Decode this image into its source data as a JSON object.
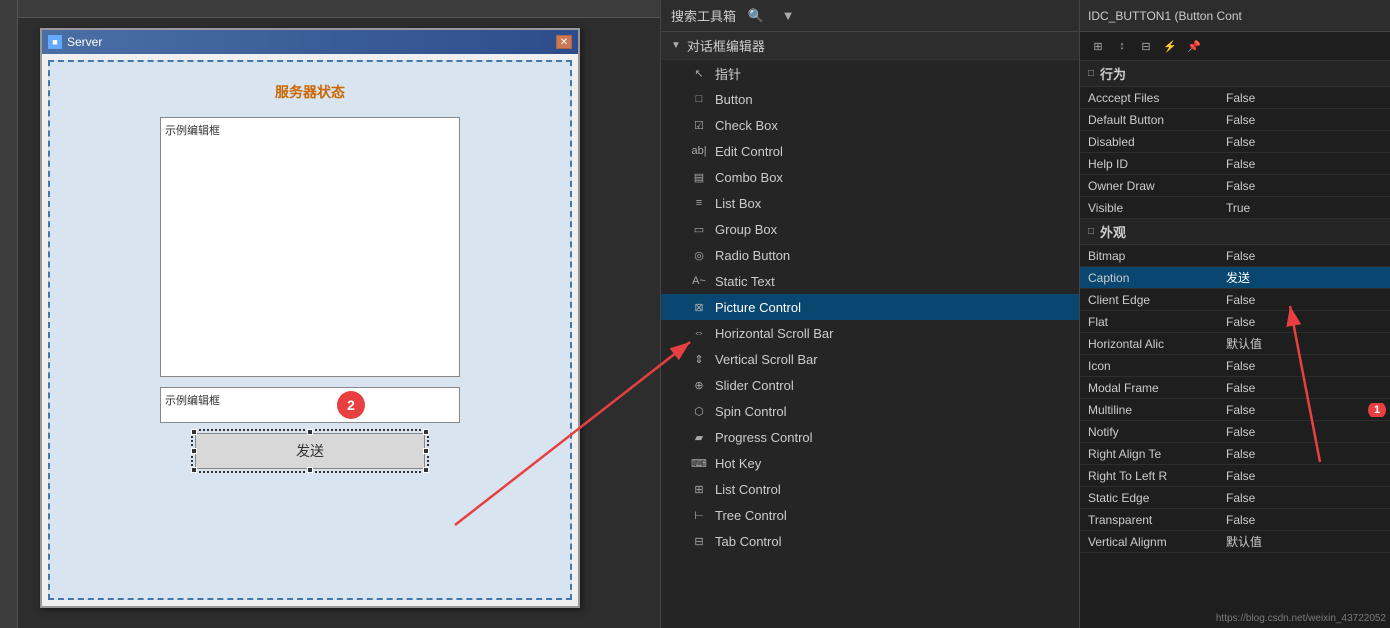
{
  "header": {
    "title": "IDC_BUTTON1 (Button Cont",
    "search_placeholder": "搜索工具箱"
  },
  "left_panel": {
    "dialog_title": "Server",
    "server_status": "服务器状态",
    "edit_box_label1": "示例编辑框",
    "edit_box_label2": "示例编辑框",
    "send_button_label": "发送"
  },
  "toolbox": {
    "category": "对话框编辑器",
    "items": [
      {
        "icon": "cursor",
        "label": "指针",
        "selected": false
      },
      {
        "icon": "button",
        "label": "Button",
        "selected": false
      },
      {
        "icon": "checkbox",
        "label": "Check Box",
        "selected": false
      },
      {
        "icon": "edit",
        "label": "Edit Control",
        "selected": false
      },
      {
        "icon": "combo",
        "label": "Combo Box",
        "selected": false
      },
      {
        "icon": "listbox",
        "label": "List Box",
        "selected": false
      },
      {
        "icon": "groupbox",
        "label": "Group Box",
        "selected": false
      },
      {
        "icon": "radio",
        "label": "Radio Button",
        "selected": false
      },
      {
        "icon": "text",
        "label": "Static Text",
        "selected": false
      },
      {
        "icon": "picture",
        "label": "Picture Control",
        "selected": true
      },
      {
        "icon": "hscroll",
        "label": "Horizontal Scroll Bar",
        "selected": false
      },
      {
        "icon": "vscroll",
        "label": "Vertical Scroll Bar",
        "selected": false
      },
      {
        "icon": "slider",
        "label": "Slider Control",
        "selected": false
      },
      {
        "icon": "spin",
        "label": "Spin Control",
        "selected": false
      },
      {
        "icon": "progress",
        "label": "Progress Control",
        "selected": false
      },
      {
        "icon": "hotkey",
        "label": "Hot Key",
        "selected": false
      },
      {
        "icon": "listctrl",
        "label": "List Control",
        "selected": false
      },
      {
        "icon": "tree",
        "label": "Tree Control",
        "selected": false
      },
      {
        "icon": "tab",
        "label": "Tab Control",
        "selected": false
      }
    ]
  },
  "properties": {
    "title": "IDC_BUTTON1 (Button Cont",
    "toolbar_buttons": [
      "grid-icon",
      "sort-icon",
      "alpha-icon",
      "filter-icon",
      "pin-icon"
    ],
    "categories": [
      {
        "name": "行为",
        "props": [
          {
            "name": "Acccept Files",
            "value": "False"
          },
          {
            "name": "Default Button",
            "value": "False"
          },
          {
            "name": "Disabled",
            "value": "False"
          },
          {
            "name": "Help ID",
            "value": "False"
          },
          {
            "name": "Owner Draw",
            "value": "False"
          },
          {
            "name": "Visible",
            "value": "True"
          }
        ]
      },
      {
        "name": "外观",
        "props": [
          {
            "name": "Bitmap",
            "value": "False"
          },
          {
            "name": "Caption",
            "value": "发送",
            "selected": true
          },
          {
            "name": "Client Edge",
            "value": "False"
          },
          {
            "name": "Flat",
            "value": "False"
          },
          {
            "name": "Horizontal Alic",
            "value": "默认值"
          },
          {
            "name": "Icon",
            "value": "False"
          },
          {
            "name": "Modal Frame",
            "value": "False"
          },
          {
            "name": "Multiline",
            "value": "False"
          },
          {
            "name": "Notify",
            "value": "False"
          },
          {
            "name": "Right Align Te",
            "value": "False"
          },
          {
            "name": "Right To Left R",
            "value": "False"
          },
          {
            "name": "Static Edge",
            "value": "False"
          },
          {
            "name": "Transparent",
            "value": "False"
          },
          {
            "name": "Vertical Alignm",
            "value": "默认值"
          }
        ]
      }
    ]
  },
  "watermark": "https://blog.csdn.net/weixin_43722052"
}
